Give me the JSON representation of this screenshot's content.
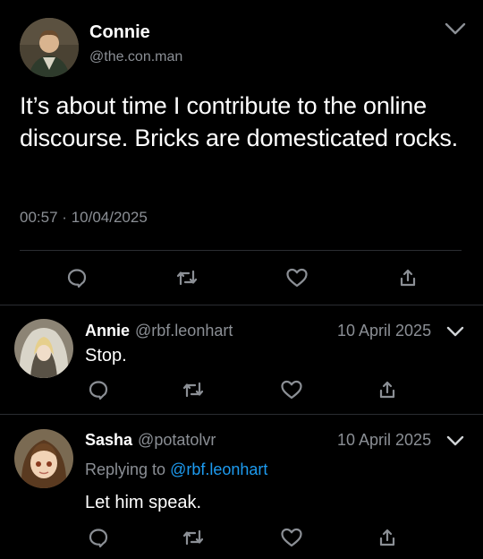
{
  "main_tweet": {
    "name": "Connie",
    "handle": "@the.con.man",
    "text": "It’s about time I contribute to the online discourse. Bricks are domesticated rocks.",
    "time": "00:57",
    "separator": "·",
    "date": "10/04/2025"
  },
  "replies": [
    {
      "name": "Annie",
      "handle": "@rbf.leonhart",
      "date": "10 April 2025",
      "text": "Stop."
    },
    {
      "name": "Sasha",
      "handle": "@potatolvr",
      "date": "10 April 2025",
      "replying_prefix": "Replying to",
      "replying_to": "@rbf.leonhart",
      "text": "Let him speak."
    }
  ],
  "icons": {
    "reply": "reply-icon",
    "retweet": "retweet-icon",
    "like": "heart-icon",
    "share": "share-icon",
    "more": "chevron-down-icon"
  },
  "colors": {
    "background": "#000000",
    "text": "#ffffff",
    "secondary": "#8b8f95",
    "link": "#1d9bf0",
    "divider": "#2a2d31"
  }
}
